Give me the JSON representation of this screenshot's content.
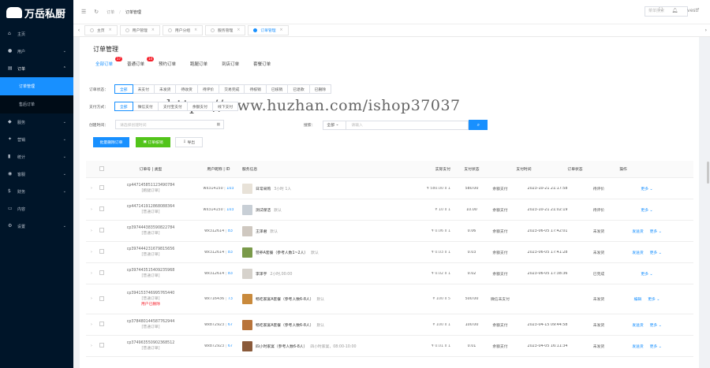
{
  "brand": {
    "logo_text": "万岳私厨"
  },
  "sidebar": {
    "items": [
      {
        "label": "主页",
        "icon": "home-icon",
        "arrow": ""
      },
      {
        "label": "用户",
        "icon": "user-icon",
        "arrow": "⌄"
      },
      {
        "label": "订单",
        "icon": "cart-icon",
        "arrow": "⌃",
        "open": true
      },
      {
        "label": "服务",
        "icon": "service-icon",
        "arrow": "⌄"
      },
      {
        "label": "营销",
        "icon": "marketing-icon",
        "arrow": "⌄"
      },
      {
        "label": "统计",
        "icon": "chart-icon",
        "arrow": "⌄"
      },
      {
        "label": "客服",
        "icon": "support-icon",
        "arrow": "⌄"
      },
      {
        "label": "财务",
        "icon": "finance-icon",
        "arrow": "⌄"
      },
      {
        "label": "内容",
        "icon": "content-icon",
        "arrow": ""
      },
      {
        "label": "设置",
        "icon": "gear-icon",
        "arrow": "⌄"
      }
    ],
    "sub_items": [
      {
        "label": "订单管理",
        "active": true
      },
      {
        "label": "售后订单"
      }
    ]
  },
  "header": {
    "breadcrumb": [
      "订单",
      "订单管理"
    ],
    "search_placeholder": "菜单搜索",
    "user": "vestf"
  },
  "tabs": [
    {
      "label": "主页"
    },
    {
      "label": "用户管理"
    },
    {
      "label": "用户分组"
    },
    {
      "label": "服务管理"
    },
    {
      "label": "订单管理",
      "active": true
    }
  ],
  "page": {
    "title": "订单管理"
  },
  "status_tabs": [
    {
      "label": "全部订单",
      "badge": "17",
      "active": true
    },
    {
      "label": "普通订单",
      "badge": "14"
    },
    {
      "label": "预约订单",
      "badge": ""
    },
    {
      "label": "跑腿订单",
      "badge": ""
    },
    {
      "label": "到店订单",
      "badge": ""
    },
    {
      "label": "套餐订单",
      "badge": ""
    }
  ],
  "watermark": "https://www.huzhan.com/ishop37037",
  "filters": {
    "status_label": "订单状态：",
    "status_options": [
      "全部",
      "未支付",
      "未发货",
      "待收货",
      "待评价",
      "交易完成",
      "待核销",
      "已核销",
      "已退款",
      "已删除"
    ],
    "pay_label": "支付方式：",
    "pay_options": [
      "全部",
      "微信支付",
      "支付宝支付",
      "余额支付",
      "线下支付"
    ],
    "time_label": "创建时间：",
    "time_placeholder": "请选择创建时间",
    "search_label": "搜索：",
    "search_select": "全部",
    "search_placeholder": "请输入"
  },
  "actions": {
    "batch_delete": "批量删除订单",
    "verify": "订单核销",
    "export": "导出"
  },
  "table": {
    "headers": [
      "订单号 | 类型",
      "用户昵称 | ID",
      "服务信息",
      "实际支付",
      "支付状态",
      "支付时间",
      "订单状态",
      "操作"
    ],
    "rows": [
      {
        "order_no": "cp447145851123490784",
        "type": "[跑腿订单]",
        "user_name": "wx314150",
        "user_id": "103",
        "goods": "日常采购",
        "spec": "3小时 1人",
        "price": "¥ 580.00 x 1",
        "paid": "580.00",
        "pay_status": "余额支付",
        "pay_time": "2023-10-21 21:17:58",
        "status": "待评价",
        "ops": [
          "更多 ⌄"
        ],
        "thumb": "#e8e2d8"
      },
      {
        "order_no": "cp447141912868088364",
        "type": "[普通订单]",
        "user_name": "wx314150",
        "user_id": "103",
        "goods": "测试保洁",
        "spec": "默认",
        "price": "¥ 10 x 1",
        "paid": "10.00",
        "pay_status": "余额支付",
        "pay_time": "2023-10-21 21:02:19",
        "status": "待评价",
        "ops": [
          "更多 ⌄"
        ],
        "thumb": "#c8cfd6"
      },
      {
        "order_no": "cp397444383590822784",
        "type": "[普通订单]",
        "user_name": "wx312614",
        "user_id": "83",
        "goods": "王泽君",
        "spec": "默认",
        "price": "¥ 0.06 x 1",
        "paid": "0.06",
        "pay_status": "余额支付",
        "pay_time": "2023-06-05 17:42:01",
        "status": "未发货",
        "ops": [
          "发送货",
          "更多 ⌄"
        ],
        "thumb": "#cfc8c0"
      },
      {
        "order_no": "cp397444231679815656",
        "type": "[普通订单]",
        "user_name": "wx312614",
        "user_id": "83",
        "goods": "营养A套餐（参考人数1~2人）",
        "spec": "默认",
        "price": "¥ 0.03 x 1",
        "paid": "0.03",
        "pay_status": "余额支付",
        "pay_time": "2023-06-05 17:41:28",
        "status": "未发货",
        "ops": [
          "发送货",
          "更多 ⌄"
        ],
        "thumb": "#7a9a4a"
      },
      {
        "order_no": "cp397443515409235968",
        "type": "[普通订单]",
        "user_name": "wx312614",
        "user_id": "83",
        "goods": "李泽宇",
        "spec": "2小时,00:00",
        "price": "¥ 0.02 x 1",
        "paid": "0.02",
        "pay_status": "余额支付",
        "pay_time": "2023-06-05 17:38:36",
        "status": "已完成",
        "ops": [
          "更多 ⌄"
        ],
        "thumb": "#d6d2cc"
      },
      {
        "order_no": "cp394153746995765440",
        "type": "[普通订单]",
        "user_name": "wx716436",
        "user_id": "73",
        "goods": "畅吃家宴A套餐（参考人数6-8人）",
        "spec": "默认",
        "price": "¥ 100 x 5",
        "paid": "500.00",
        "pay_status": "微信未支付",
        "pay_time": "",
        "status": "未发货",
        "ops": [
          "编辑",
          "更多 ⌄"
        ],
        "thumb": "#c98a3c",
        "deleted": "用户已删除"
      },
      {
        "order_no": "cp378480144587762944",
        "type": "[普通订单]",
        "user_name": "wx872923",
        "user_id": "67",
        "goods": "畅吃家宴A套餐（参考人数6-8人）",
        "spec": "默认",
        "price": "¥ 100 x 1",
        "paid": "100.00",
        "pay_status": "余额支付",
        "pay_time": "2023-04-15 09:44:58",
        "status": "未发货",
        "ops": [
          "发送货",
          "更多 ⌄"
        ],
        "thumb": "#b8743a"
      },
      {
        "order_no": "cp374963550902368512",
        "type": "[普通订单]",
        "user_name": "wx872923",
        "user_id": "67",
        "goods": "四小时家宴（参考人数6-8人）",
        "spec": "四小时家宴，08:00-10:00",
        "price": "¥ 0.01 x 1",
        "paid": "0.01",
        "pay_status": "余额支付",
        "pay_time": "2023-04-05 16:11:34",
        "status": "未发货",
        "ops": [
          "发送货",
          "更多 ⌄"
        ],
        "thumb": "#8a5a3a"
      }
    ]
  },
  "colors": {
    "primary": "#1890ff",
    "sidebar": "#001529",
    "success": "#52c41a",
    "danger": "#f5222d"
  }
}
